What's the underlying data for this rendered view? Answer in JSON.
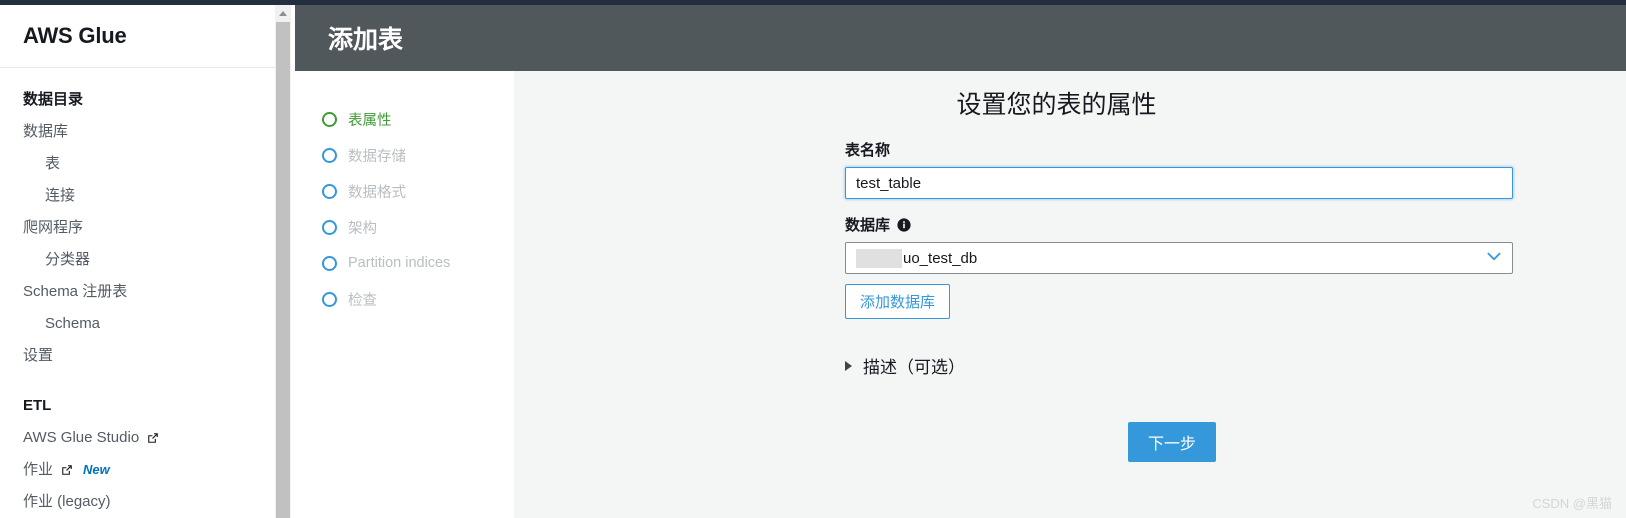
{
  "colors": {
    "top_strip": "#232f3e",
    "header_bar": "#50585c",
    "accent_blue": "#3498db",
    "active_green": "#3f9c35",
    "content_bg": "#f4f5f5",
    "link_blue": "#0073bb"
  },
  "sidebar": {
    "brand": "AWS Glue",
    "groups": [
      {
        "title": "数据目录",
        "items": [
          {
            "label": "数据库",
            "indent": false,
            "external": false,
            "badge": ""
          },
          {
            "label": "表",
            "indent": true,
            "external": false,
            "badge": ""
          },
          {
            "label": "连接",
            "indent": true,
            "external": false,
            "badge": ""
          },
          {
            "label": "爬网程序",
            "indent": false,
            "external": false,
            "badge": ""
          },
          {
            "label": "分类器",
            "indent": true,
            "external": false,
            "badge": ""
          },
          {
            "label": "Schema 注册表",
            "indent": false,
            "external": false,
            "badge": ""
          },
          {
            "label": "Schema",
            "indent": true,
            "external": false,
            "badge": ""
          },
          {
            "label": "设置",
            "indent": false,
            "external": false,
            "badge": ""
          }
        ]
      },
      {
        "title": "ETL",
        "items": [
          {
            "label": "AWS Glue Studio",
            "indent": false,
            "external": true,
            "badge": ""
          },
          {
            "label": "作业",
            "indent": false,
            "external": true,
            "badge": "New"
          },
          {
            "label": "作业 (legacy)",
            "indent": false,
            "external": false,
            "badge": ""
          }
        ]
      }
    ]
  },
  "header": {
    "title": "添加表"
  },
  "wizard": {
    "steps": [
      {
        "label": "表属性",
        "active": true
      },
      {
        "label": "数据存储",
        "active": false
      },
      {
        "label": "数据格式",
        "active": false
      },
      {
        "label": "架构",
        "active": false
      },
      {
        "label": "Partition indices",
        "active": false
      },
      {
        "label": "检查",
        "active": false
      }
    ]
  },
  "main": {
    "title": "设置您的表的属性",
    "table_name": {
      "label": "表名称",
      "value": "test_table",
      "placeholder": ""
    },
    "database": {
      "label": "数据库",
      "value": "uo_test_db",
      "redacted": true
    },
    "add_database_button": "添加数据库",
    "description_disclosure": "描述（可选）",
    "next_button": "下一步"
  },
  "watermark": "CSDN @黑猫"
}
